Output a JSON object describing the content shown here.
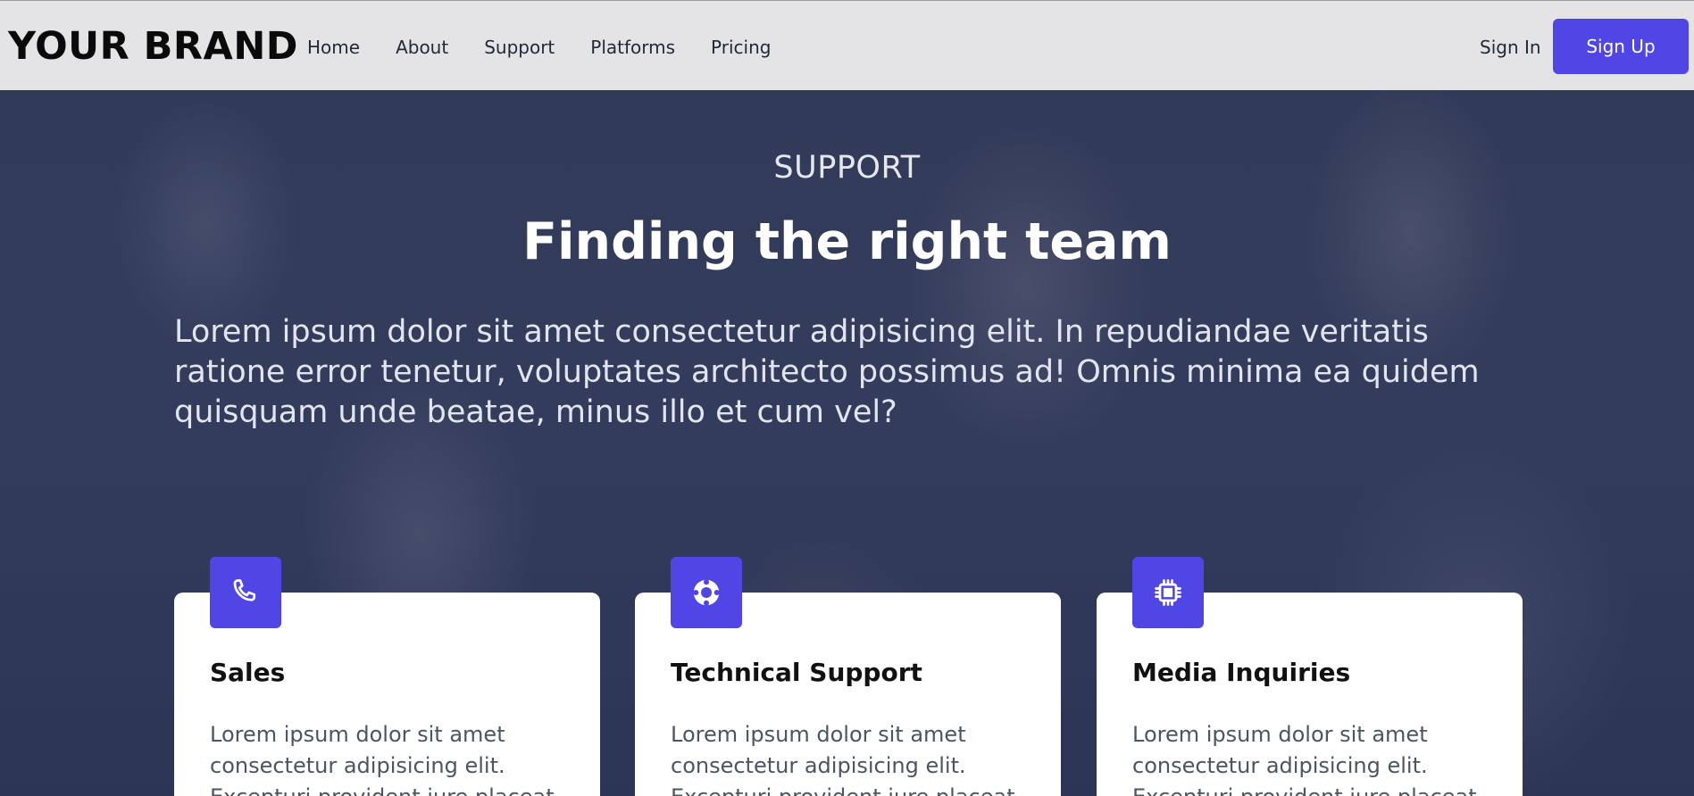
{
  "header": {
    "brand": "YOUR BRAND",
    "nav": [
      "Home",
      "About",
      "Support",
      "Platforms",
      "Pricing"
    ],
    "sign_in": "Sign In",
    "sign_up": "Sign Up"
  },
  "hero": {
    "eyebrow": "SUPPORT",
    "title": "Finding the right team",
    "lead": "Lorem ipsum dolor sit amet consectetur adipisicing elit. In repudiandae veritatis ratione error tenetur, voluptates architecto possimus ad! Omnis minima ea quidem quisquam unde beatae, minus illo et cum vel?"
  },
  "cards": [
    {
      "icon": "phone-icon",
      "title": "Sales",
      "text": "Lorem ipsum dolor sit amet consectetur adipisicing elit. Excepturi provident iure placeat"
    },
    {
      "icon": "lifebuoy-icon",
      "title": "Technical Support",
      "text": "Lorem ipsum dolor sit amet consectetur adipisicing elit. Excepturi provident iure placeat"
    },
    {
      "icon": "cpu-chip-icon",
      "title": "Media Inquiries",
      "text": "Lorem ipsum dolor sit amet consectetur adipisicing elit. Excepturi provident iure placeat"
    }
  ],
  "colors": {
    "accent": "#4f46e5",
    "header_bg": "#e4e4e7",
    "hero_tint": "#2c3550"
  }
}
